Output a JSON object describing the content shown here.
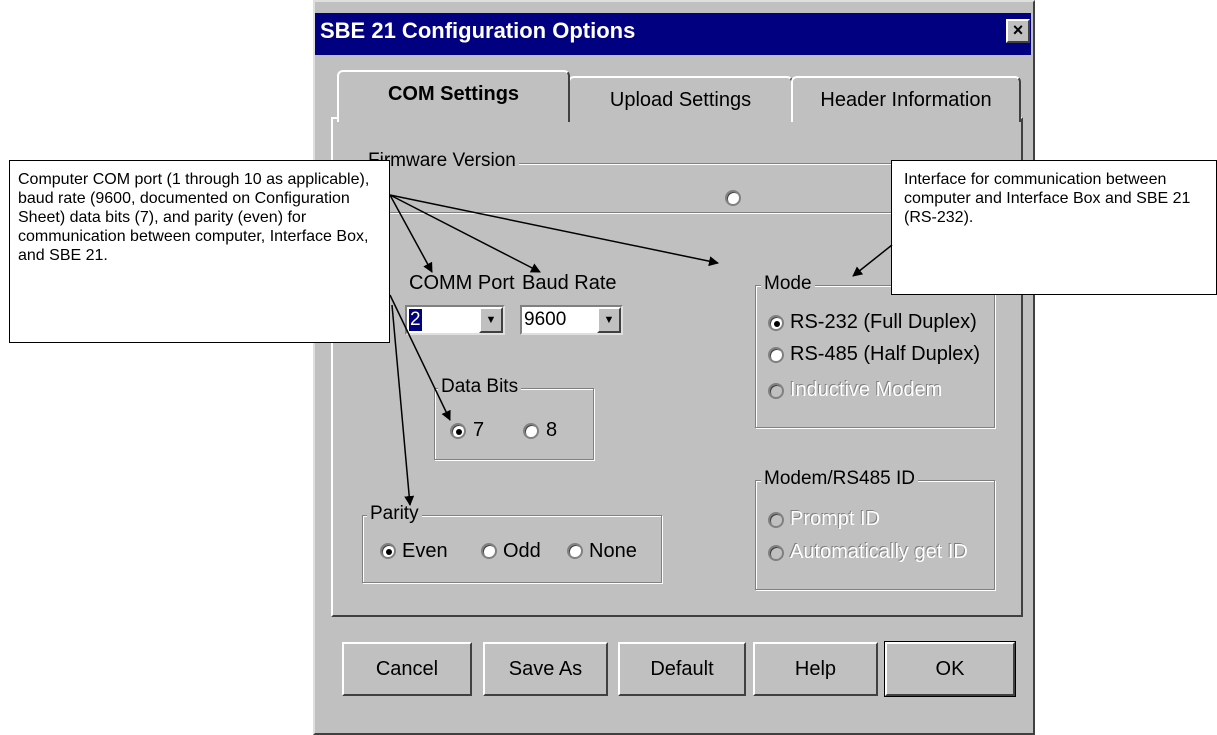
{
  "window": {
    "title": "SBE 21 Configuration Options",
    "close_glyph": "×"
  },
  "tabs": [
    {
      "label": "COM Settings",
      "active": true
    },
    {
      "label": "Upload Settings",
      "active": false
    },
    {
      "label": "Header Information",
      "active": false
    }
  ],
  "firmware": {
    "label": "Firmware Version"
  },
  "comm_port": {
    "label": "COMM Port",
    "value": "2"
  },
  "baud_rate": {
    "label": "Baud Rate",
    "value": "9600"
  },
  "data_bits": {
    "label": "Data Bits",
    "options": [
      {
        "label": "7",
        "checked": true
      },
      {
        "label": "8",
        "checked": false
      }
    ]
  },
  "parity": {
    "label": "Parity",
    "options": [
      {
        "label": "Even",
        "checked": true
      },
      {
        "label": "Odd",
        "checked": false
      },
      {
        "label": "None",
        "checked": false
      }
    ]
  },
  "mode": {
    "label": "Mode",
    "options": [
      {
        "label": "RS-232 (Full Duplex)",
        "checked": true,
        "enabled": true
      },
      {
        "label": "RS-485 (Half Duplex)",
        "checked": false,
        "enabled": true
      },
      {
        "label": "Inductive Modem",
        "checked": false,
        "enabled": false
      }
    ]
  },
  "modem_id": {
    "label": "Modem/RS485 ID",
    "options": [
      {
        "label": "Prompt ID",
        "enabled": false
      },
      {
        "label": "Automatically get ID",
        "enabled": false
      }
    ]
  },
  "buttons": {
    "cancel": "Cancel",
    "save_as": "Save As",
    "default": "Default",
    "help": "Help",
    "ok": "OK"
  },
  "callouts": {
    "left": "Computer COM port (1 through 10 as applicable), baud rate (9600, documented on Configuration Sheet) data bits (7), and parity (even) for communication between computer, Interface Box, and SBE 21.",
    "right": "Interface for communication between computer and Interface Box and SBE 21 (RS-232)."
  },
  "colors": {
    "title_bar": "#000080",
    "dialog_bg": "#c0c0c0",
    "selection": "#000080"
  }
}
